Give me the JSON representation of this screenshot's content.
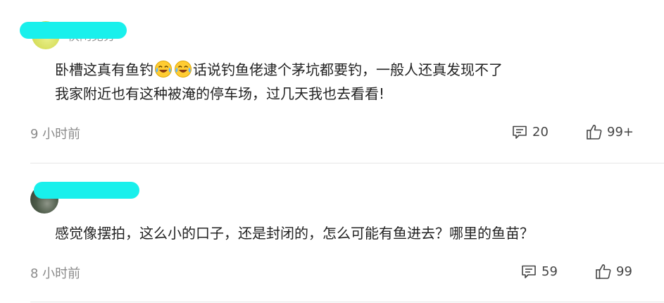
{
  "comments": [
    {
      "username_visible": "快闲见分",
      "line1_part1": "卧槽这真有鱼钓",
      "line1_part2": "话说钓鱼佬逮个茅坑都要钓，一般人还真发现不了",
      "line2": "我家附近也有这种被淹的停车场，过几天我也去看看!",
      "emoji_name": "laughing-crying-emoji",
      "time": "9 小时前",
      "reply_count": "20",
      "like_count": "99+"
    },
    {
      "username_visible": "",
      "line1": "感觉像摆拍，这么小的口子，还是封闭的，怎么可能有鱼进去？哪里的鱼苗？",
      "time": "8 小时前",
      "reply_count": "59",
      "like_count": "99"
    }
  ],
  "icons": {
    "reply": "comment-bubble-icon",
    "like": "thumbs-up-icon"
  },
  "colors": {
    "redaction": "#19f0ec",
    "text": "#222222",
    "meta": "#8a8a8a",
    "divider": "#e6e6e6"
  }
}
